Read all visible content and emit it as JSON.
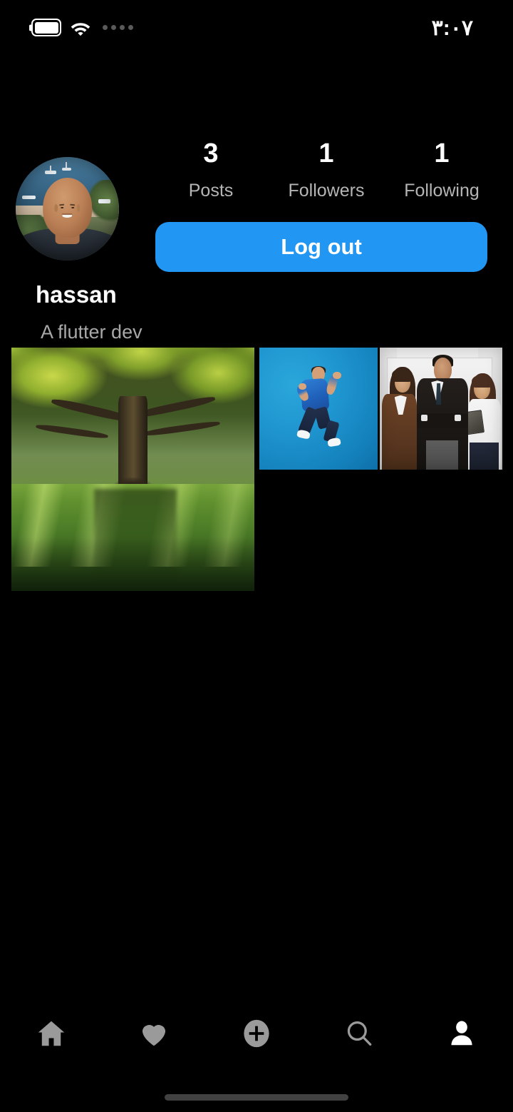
{
  "theme": {
    "background": "#000000",
    "accent_blue": "#2196f3",
    "text_primary": "#ffffff",
    "text_secondary": "#b5b5b5",
    "nav_inactive": "#9a9a9a",
    "nav_active": "#ffffff"
  },
  "status_bar": {
    "time": "٣:٠٧",
    "battery_icon": "battery-full-icon",
    "wifi_icon": "wifi-icon",
    "signal_icon": "signal-dots-icon"
  },
  "profile": {
    "avatar_alt": "hassan profile photo",
    "username": "hassan",
    "bio": "A flutter dev",
    "stats": [
      {
        "value": "3",
        "label": "Posts"
      },
      {
        "value": "1",
        "label": "Followers"
      },
      {
        "value": "1",
        "label": "Following"
      }
    ],
    "logout_label": "Log out"
  },
  "photos": [
    {
      "name": "photo-tree",
      "alt": "Large tree in a sunlit green meadow"
    },
    {
      "name": "photo-jump",
      "alt": "Man in blue shirt jumping on blue background"
    },
    {
      "name": "photo-team",
      "alt": "Three business people standing together"
    }
  ],
  "bottom_nav": [
    {
      "name": "nav-home",
      "icon": "home-icon",
      "active": false
    },
    {
      "name": "nav-activity",
      "icon": "heart-icon",
      "active": false
    },
    {
      "name": "nav-add",
      "icon": "plus-circle-icon",
      "active": false
    },
    {
      "name": "nav-search",
      "icon": "search-icon",
      "active": false
    },
    {
      "name": "nav-profile",
      "icon": "person-icon",
      "active": true
    }
  ]
}
